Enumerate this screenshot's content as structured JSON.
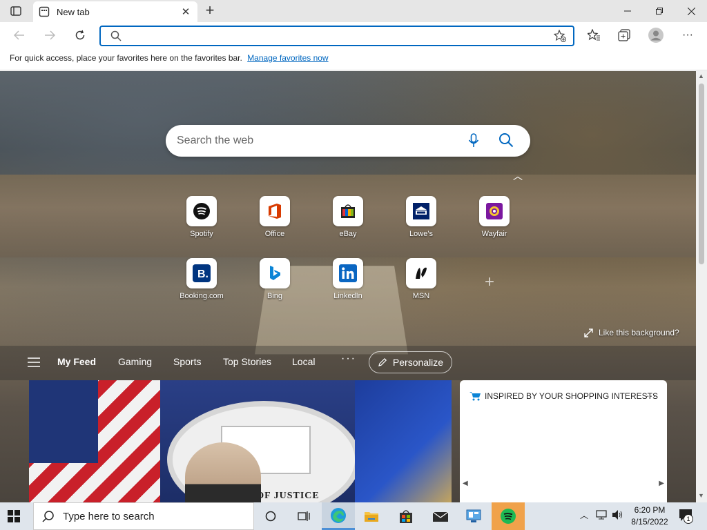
{
  "browser": {
    "tab": {
      "title": "New tab"
    },
    "address": {
      "value": "",
      "placeholder": ""
    },
    "favorites_bar": {
      "text": "For quick access, place your favorites here on the favorites bar.",
      "link": "Manage favorites now"
    }
  },
  "ntp": {
    "search_placeholder": "Search the web",
    "tiles": [
      {
        "label": "Spotify",
        "icon": "spotify-icon"
      },
      {
        "label": "Office",
        "icon": "office-icon"
      },
      {
        "label": "eBay",
        "icon": "ebay-icon"
      },
      {
        "label": "Lowe's",
        "icon": "lowes-icon"
      },
      {
        "label": "Wayfair",
        "icon": "wayfair-icon"
      },
      {
        "label": "Booking.com",
        "icon": "booking-icon"
      },
      {
        "label": "Bing",
        "icon": "bing-icon"
      },
      {
        "label": "LinkedIn",
        "icon": "linkedin-icon"
      },
      {
        "label": "MSN",
        "icon": "msn-icon"
      }
    ],
    "like_background": "Like this background?",
    "feed_nav": {
      "items": [
        "My Feed",
        "Gaming",
        "Sports",
        "Top Stories",
        "Local"
      ],
      "more": "···",
      "personalize": "Personalize"
    },
    "news_card": {
      "seal_text": "RTMENT OF JUSTICE"
    },
    "shopping_card": {
      "title": "INSPIRED BY YOUR SHOPPING INTERESTS"
    }
  },
  "taskbar": {
    "search_placeholder": "Type here to search",
    "clock_time": "6:20 PM",
    "clock_date": "8/15/2022",
    "notification_count": "1"
  },
  "colors": {
    "accent": "#0067c0",
    "spotify_green": "#1db954",
    "taskbar": "#dfe5ec"
  }
}
